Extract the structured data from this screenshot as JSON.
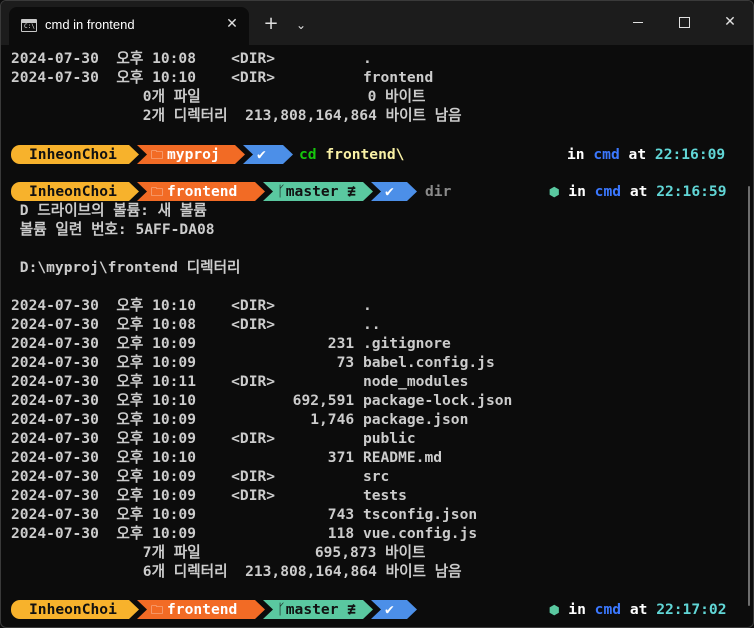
{
  "titlebar": {
    "tab_title": "cmd in frontend",
    "tab_icon": "cmd-terminal-icon",
    "close_tab_glyph": "✕",
    "new_tab_glyph": "+",
    "dropdown_glyph": "⌄",
    "close_window_glyph": "✕"
  },
  "colors": {
    "user_segment": "#f7b22c",
    "dir_segment": "#f26b25",
    "git_segment": "#5ac8a0",
    "status_segment": "#4c8fe8",
    "command": "#16c60c",
    "argument": "#f9f1a5",
    "time": "#61d6d6",
    "shell": "#3b78ff"
  },
  "top_output": [
    "2024-07-30  오후 10:08    <DIR>          .",
    "2024-07-30  오후 10:10    <DIR>          frontend",
    "               0개 파일                   0 바이트",
    "               2개 디렉터리  213,808,164,864 바이트 남음"
  ],
  "prompt1": {
    "user": "InheonChoi",
    "dir": "myproj",
    "status": "✔",
    "command": "cd",
    "argument": "frontend\\",
    "in": "in",
    "shell": "cmd",
    "at": "at",
    "time": "22:16:09"
  },
  "prompt2": {
    "user": "InheonChoi",
    "dir": "frontend",
    "git": "master ≢",
    "status": "✔",
    "command": "dir",
    "node_icon": "⬢",
    "in": "in",
    "shell": "cmd",
    "at": "at",
    "time": "22:16:59"
  },
  "dir_header": [
    " D 드라이브의 볼륨: 새 볼륨",
    " 볼륨 일련 번호: 5AFF-DA08",
    "",
    " D:\\myproj\\frontend 디렉터리",
    ""
  ],
  "listing": [
    "2024-07-30  오후 10:10    <DIR>          .",
    "2024-07-30  오후 10:08    <DIR>          ..",
    "2024-07-30  오후 10:09               231 .gitignore",
    "2024-07-30  오후 10:09                73 babel.config.js",
    "2024-07-30  오후 10:11    <DIR>          node_modules",
    "2024-07-30  오후 10:10           692,591 package-lock.json",
    "2024-07-30  오후 10:09             1,746 package.json",
    "2024-07-30  오후 10:09    <DIR>          public",
    "2024-07-30  오후 10:10               371 README.md",
    "2024-07-30  오후 10:09    <DIR>          src",
    "2024-07-30  오후 10:09    <DIR>          tests",
    "2024-07-30  오후 10:09               743 tsconfig.json",
    "2024-07-30  오후 10:09               118 vue.config.js",
    "               7개 파일             695,873 바이트",
    "               6개 디렉터리  213,808,164,864 바이트 남음"
  ],
  "prompt3": {
    "user": "InheonChoi",
    "dir": "frontend",
    "git": "master ≢",
    "status": "✔",
    "node_icon": "⬢",
    "in": "in",
    "shell": "cmd",
    "at": "at",
    "time": "22:17:02"
  }
}
